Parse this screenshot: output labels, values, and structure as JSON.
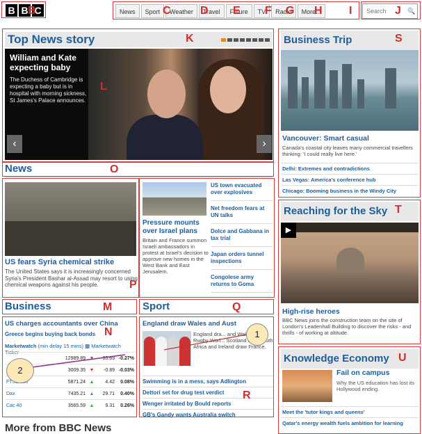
{
  "logo": [
    "B",
    "B",
    "C"
  ],
  "nav": [
    "News",
    "Sport",
    "Weather",
    "Travel",
    "Future",
    "TV",
    "Radio",
    "More..."
  ],
  "search": {
    "placeholder": "Search"
  },
  "top_news": {
    "heading": "Top News story",
    "title": "William and Kate expecting baby",
    "desc": "The Duchess of Cambridge is expecting a baby but is in hospital with morning sickness, St James's Palace announces.",
    "slides_total": 8,
    "slide_active": 1
  },
  "news": {
    "heading": "News",
    "main": {
      "title": "US fears Syria chemical strike",
      "desc": "The United States says it is increasingly concerned Syria's President Bashar al-Assad may resort to using chemical weapons against his people."
    },
    "second": {
      "title": "Pressure mounts over Israel plans",
      "desc": "Britain and France summon Israeli ambassadors in protest at Israel's decision to approve new homes in the West Bank and East Jerusalem."
    },
    "links": [
      "US town evacuated over explosives",
      "Net freedom fears at UN talks",
      "Dolce and Gabbana in tax trial",
      "Japan orders tunnel inspections",
      "Congolese army returns to Goma"
    ]
  },
  "business": {
    "heading": "Business",
    "top_link": "US charges accountants over China",
    "sub_link": "Greece begins buying back bonds",
    "market_title": "Marketwatch",
    "market_note": "(min delay 15 mins)",
    "market_ticker": "Marketwatch Ticker",
    "rows": [
      {
        "name": "",
        "value": "12989.89",
        "dir": "down",
        "change": "-35.69",
        "pct": "-0.27%"
      },
      {
        "name": "",
        "value": "3009.35",
        "dir": "down",
        "change": "-0.89",
        "pct": "-0.03%"
      },
      {
        "name": "FTSE 100",
        "value": "5871.24",
        "dir": "up",
        "change": "4.42",
        "pct": "0.08%"
      },
      {
        "name": "Dax",
        "value": "7435.21",
        "dir": "up",
        "change": "29.71",
        "pct": "0.40%"
      },
      {
        "name": "Cac 40",
        "value": "3565.59",
        "dir": "up",
        "change": "9.31",
        "pct": "0.26%"
      }
    ]
  },
  "sport": {
    "heading": "Sport",
    "top_title": "England draw Wales and Aust",
    "top_desc": "England dra... and Wales i... Rugby Worl... Scotland face South Africa and Ireland draw France.",
    "links": [
      "Swimming is in a mess, says Adlington",
      "Dettori set for drug test verdict",
      "Wenger irritated by Bould reports",
      "GB's Gandy wants Australia switch"
    ]
  },
  "more": {
    "heading": "More from BBC News"
  },
  "business_trip": {
    "heading": "Business Trip",
    "title": "Vancouver: Smart casual",
    "desc": "Canada's coastal city leaves many commercial travellers thinking: 'I could really live here.'",
    "links": [
      "Delhi: Extremes and contradictions",
      "Las Vegas: America's conference hub",
      "Chicago: Booming business in the Windy City"
    ]
  },
  "sky": {
    "heading": "Reaching for the Sky",
    "title": "High-rise heroes",
    "desc": "BBC News joins the construction team on the site of London's Leadenhall Building to discover the risks - and thrills - of working at altitude."
  },
  "knowledge": {
    "heading": "Knowledge Economy",
    "title": "Fail on campus",
    "desc": "Why the US education has lost its Hollywood ending.",
    "links": [
      "Meet the 'tutor kings and queens'",
      "Qatar's energy wealth fuels ambition for learning"
    ]
  },
  "annotations": {
    "letters": [
      "B",
      "C",
      "D",
      "E",
      "F",
      "G",
      "H",
      "I",
      "J",
      "K",
      "L",
      "M",
      "N",
      "O",
      "P",
      "Q",
      "R",
      "S",
      "T",
      "U"
    ],
    "circles": [
      "1",
      "2"
    ]
  },
  "colors": {
    "link": "#1d5d9b",
    "annotation": "#d93a3a",
    "up": "#3aa53a",
    "down": "#dd3333",
    "active_dot": "#f08a00"
  }
}
